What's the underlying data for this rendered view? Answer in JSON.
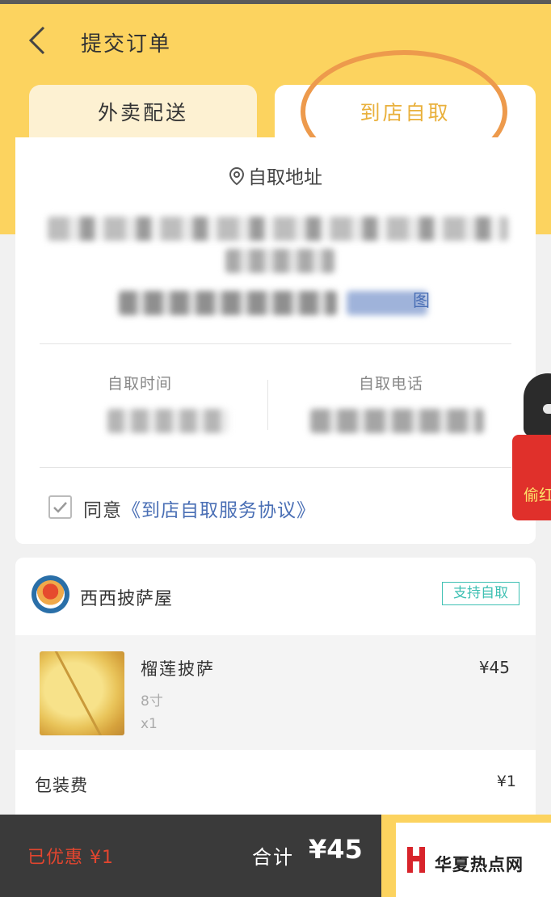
{
  "header": {
    "title": "提交订单",
    "accent_color": "#fcd35f"
  },
  "tabs": [
    {
      "label": "外卖配送",
      "active": false
    },
    {
      "label": "到店自取",
      "active": true
    }
  ],
  "pickup": {
    "address_label": "自取地址",
    "map_link": "图",
    "time_label": "自取时间",
    "phone_label": "自取电话",
    "agreement_prefix": "同意",
    "agreement_link": "《到店自取服务协议》",
    "agreement_checked": true
  },
  "shop": {
    "name": "西西披萨屋",
    "badge": "支持自取"
  },
  "order_items": [
    {
      "name": "榴莲披萨",
      "spec": "8寸",
      "qty": "x1",
      "price": "¥45"
    }
  ],
  "fees": {
    "packaging_label": "包装费",
    "packaging_value": "¥1"
  },
  "footer": {
    "discount": "已优惠 ¥1",
    "total_label": "合计",
    "total_value": "¥45"
  },
  "floating_redpacket": {
    "text": "偷红"
  },
  "watermark": {
    "text": "华夏热点网"
  }
}
